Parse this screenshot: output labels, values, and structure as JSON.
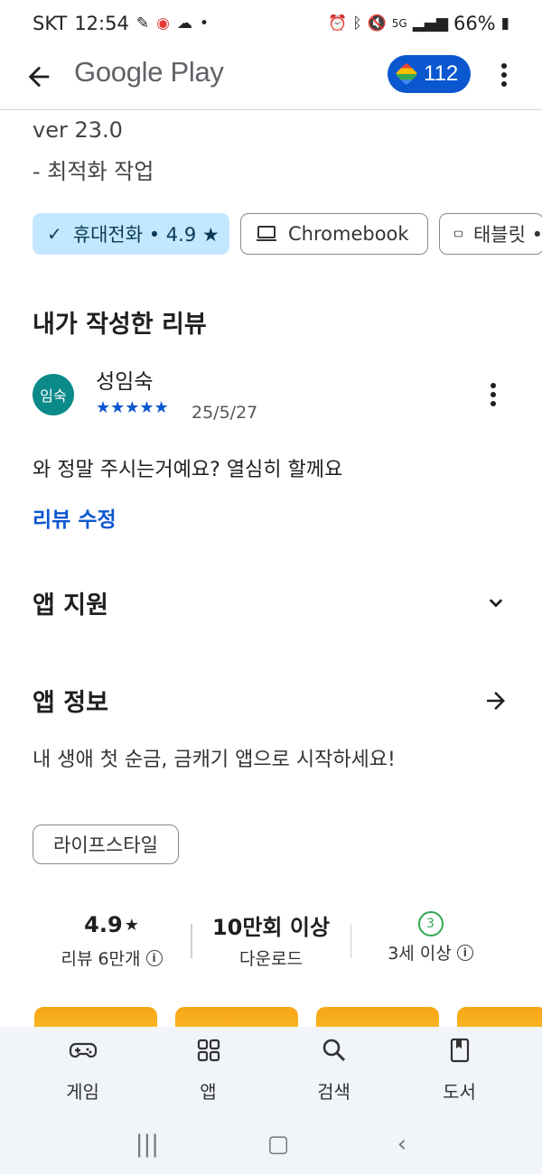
{
  "status_bar": {
    "carrier": "SKT",
    "time": "12:54",
    "battery": "66%",
    "network": "5G"
  },
  "app_bar": {
    "title": "Google Play",
    "points": "112"
  },
  "whats_new": {
    "version": "ver 23.0",
    "notes": "- 최적화 작업"
  },
  "device_chips": [
    {
      "label": "휴대전화 • 4.9 ★",
      "selected": true
    },
    {
      "label": "Chromebook",
      "selected": false
    },
    {
      "label": "태블릿 •",
      "selected": false
    }
  ],
  "my_review": {
    "heading": "내가 작성한 리뷰",
    "avatar_text": "임숙",
    "author": "성임숙",
    "stars": "★★★★★",
    "rating": 5,
    "date": "25/5/27",
    "text": "와 정말 주시는거예요? 열심히 할께요",
    "edit_label": "리뷰 수정"
  },
  "app_support": {
    "title": "앱 지원"
  },
  "app_info": {
    "title": "앱 정보",
    "description": "내 생애 첫 순금, 금캐기 앱으로 시작하세요!",
    "tag": "라이프스타일"
  },
  "stats": {
    "rating": "4.9",
    "rating_star": "★",
    "reviews": "리뷰 6만개",
    "downloads": "10만회 이상",
    "downloads_label": "다운로드",
    "age_badge": "3",
    "age_label": "3세 이상"
  },
  "bottom_nav": [
    {
      "label": "게임",
      "icon": "gamepad-icon"
    },
    {
      "label": "앱",
      "icon": "apps-grid-icon"
    },
    {
      "label": "검색",
      "icon": "search-icon"
    },
    {
      "label": "도서",
      "icon": "book-icon"
    }
  ],
  "colors": {
    "accent": "#0b57d0",
    "chip_selected": "#c2e7ff",
    "avatar": "#0b8a8a",
    "age_green": "#34a853",
    "promo": "#f7a516"
  }
}
